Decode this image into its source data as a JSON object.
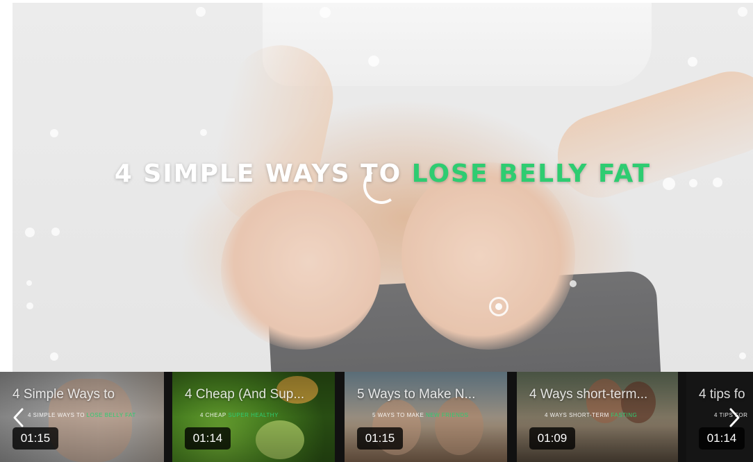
{
  "player": {
    "title_white": "4 SIMPLE WAYS TO ",
    "title_green": "LOSE BELLY FAT",
    "accent_color": "#2ecc71",
    "state": "loading"
  },
  "carousel": {
    "prev_icon": "chevron-left-icon",
    "next_icon": "chevron-right-icon",
    "items": [
      {
        "title": "4 Simple Ways to",
        "subtitle_white": "4 SIMPLE WAYS TO ",
        "subtitle_green": "LOSE BELLY FAT",
        "duration": "01:15"
      },
      {
        "title": "4 Cheap (And Sup...",
        "subtitle_white": "4 CHEAP ",
        "subtitle_green": "SUPER HEALTHY",
        "duration": "01:14"
      },
      {
        "title": "5 Ways to Make N...",
        "subtitle_white": "5 WAYS TO MAKE ",
        "subtitle_green": "NEW FRIENDS",
        "duration": "01:15"
      },
      {
        "title": "4 Ways short-term...",
        "subtitle_white": "4 WAYS SHORT-TERM ",
        "subtitle_green": "FASTING",
        "duration": "01:09"
      },
      {
        "title": "4 tips fo",
        "subtitle_white": "4 TIPS FOR ",
        "subtitle_green": "",
        "duration": "01:14"
      }
    ]
  }
}
